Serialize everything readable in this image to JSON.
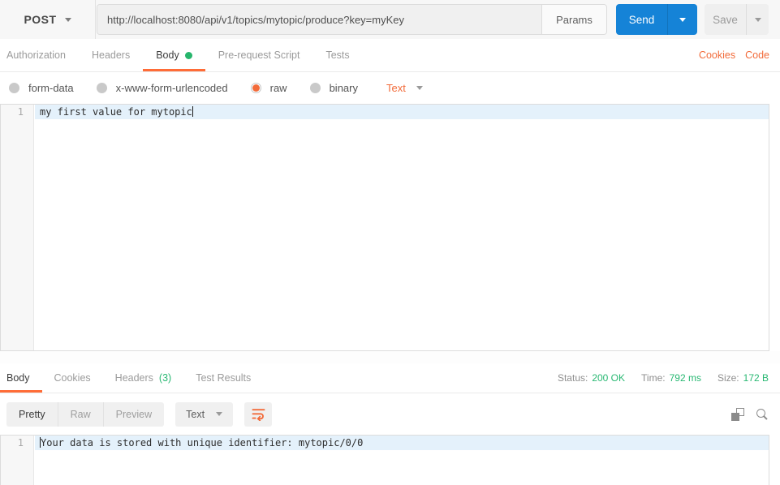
{
  "colors": {
    "accent_orange": "#ff6c37",
    "link_orange": "#f26b3a",
    "send_blue": "#1583d7",
    "success_green": "#29b873",
    "active_line_blue": "#e4f1fb"
  },
  "request_bar": {
    "method": "POST",
    "url": "http://localhost:8080/api/v1/topics/mytopic/produce?key=myKey",
    "params_label": "Params",
    "send_label": "Send",
    "save_label": "Save"
  },
  "request_tabs": {
    "items": [
      {
        "label": "Authorization"
      },
      {
        "label": "Headers"
      },
      {
        "label": "Body"
      },
      {
        "label": "Pre-request Script"
      },
      {
        "label": "Tests"
      }
    ],
    "active": "Body",
    "cookies_link": "Cookies",
    "code_link": "Code"
  },
  "body_type_bar": {
    "options": [
      "form-data",
      "x-www-form-urlencoded",
      "raw",
      "binary"
    ],
    "selected": "raw",
    "format_selected": "Text"
  },
  "request_editor": {
    "lines": [
      {
        "number": "1",
        "text": "my first value for mytopic"
      }
    ]
  },
  "response_meta": {
    "tabs": [
      "Body",
      "Cookies",
      "Headers",
      "Test Results"
    ],
    "active": "Body",
    "headers_count": "(3)",
    "status_label": "Status:",
    "status_value": "200 OK",
    "time_label": "Time:",
    "time_value": "792 ms",
    "size_label": "Size:",
    "size_value": "172 B"
  },
  "response_toolbar": {
    "views": [
      "Pretty",
      "Raw",
      "Preview"
    ],
    "active_view": "Pretty",
    "format_selected": "Text"
  },
  "response_editor": {
    "lines": [
      {
        "number": "1",
        "text": "Your data is stored with unique identifier: mytopic/0/0"
      }
    ]
  }
}
